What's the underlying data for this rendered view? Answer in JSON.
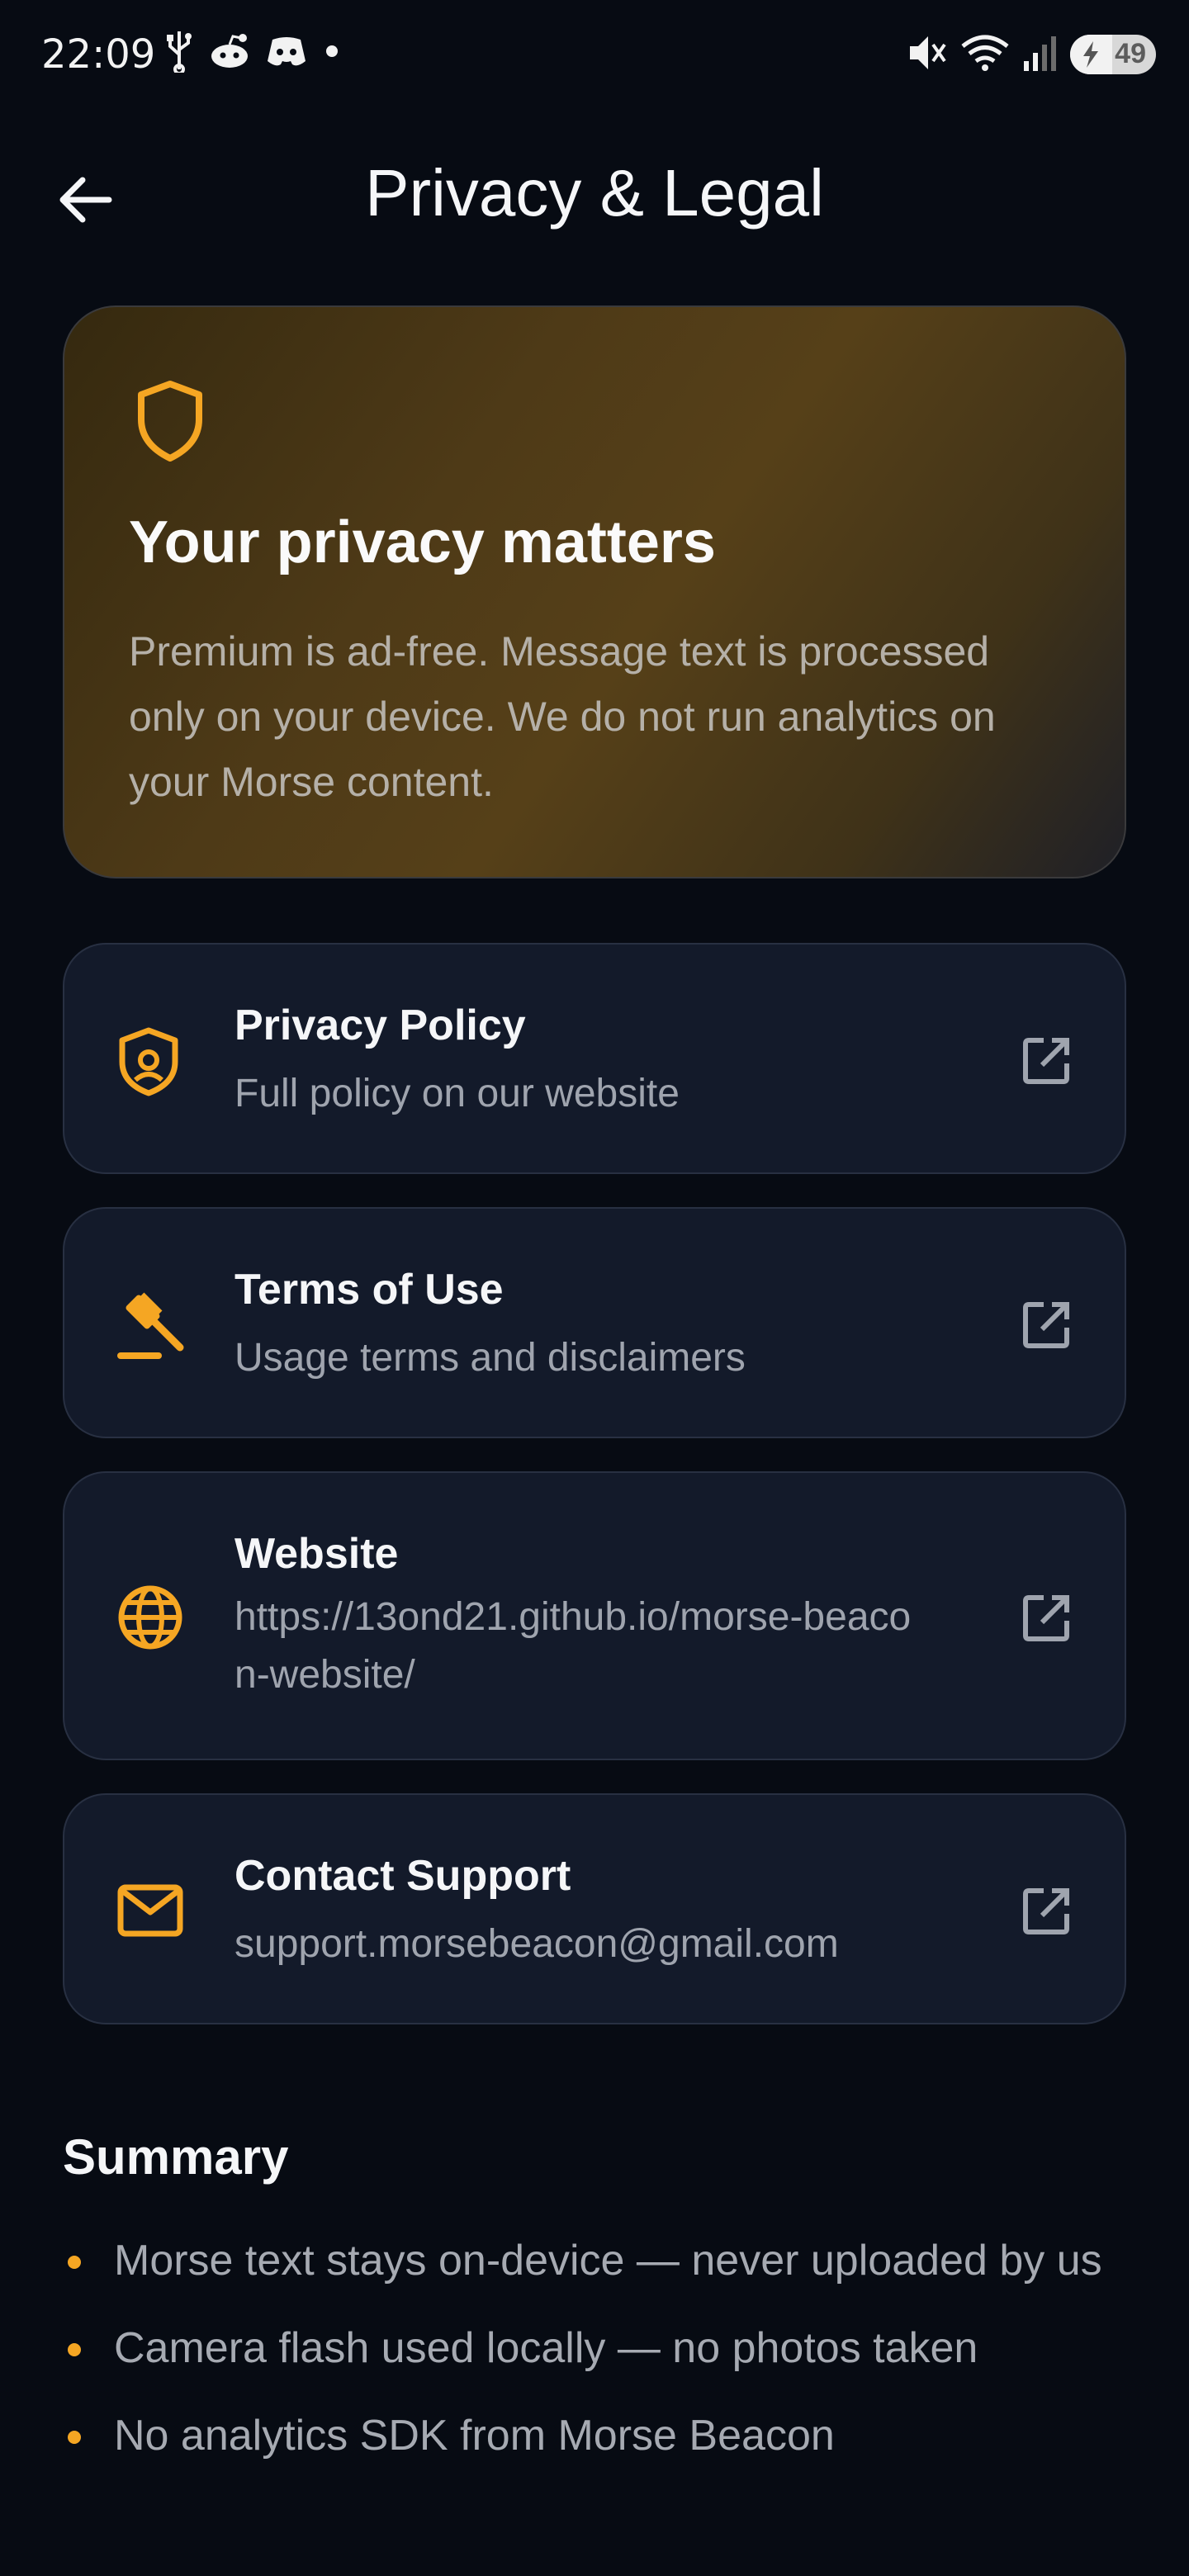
{
  "status_bar": {
    "time": "22:09",
    "battery_level": "49",
    "icons_left": [
      "usb-icon",
      "reddit-icon",
      "discord-icon",
      "dot-icon"
    ],
    "icons_right": [
      "mute-icon",
      "wifi-icon",
      "signal-icon",
      "battery-icon"
    ]
  },
  "header": {
    "title": "Privacy & Legal",
    "back_icon": "arrow-left-icon"
  },
  "hero": {
    "icon": "shield-icon",
    "title": "Your privacy matters",
    "body": "Premium is ad-free. Message text is processed only on your device. We do not run analytics on your Morse content."
  },
  "links": [
    {
      "icon": "shield-account-icon",
      "title": "Privacy Policy",
      "subtitle": "Full policy on our website"
    },
    {
      "icon": "gavel-icon",
      "title": "Terms of Use",
      "subtitle": "Usage terms and disclaimers"
    },
    {
      "icon": "globe-icon",
      "title": "Website",
      "subtitle": "https://13ond21.github.io/morse-beacon-website/"
    },
    {
      "icon": "mail-icon",
      "title": "Contact Support",
      "subtitle": "support.morsebeacon@gmail.com"
    }
  ],
  "summary": {
    "title": "Summary",
    "items": [
      "Morse text stays on-device — never uploaded by us",
      "Camera flash used locally — no photos taken",
      "No analytics SDK from Morse Beacon"
    ]
  },
  "colors": {
    "background": "#070b13",
    "card": "#131a2a",
    "accent": "#f5a623",
    "text_primary": "#f5f6f8",
    "text_secondary": "#9fa4ae"
  }
}
